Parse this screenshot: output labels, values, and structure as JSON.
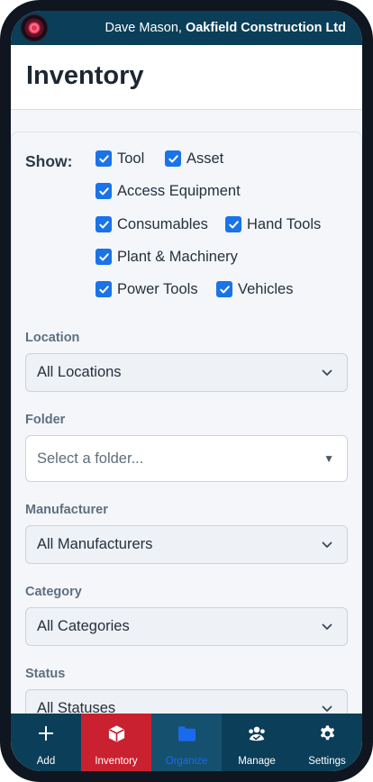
{
  "header": {
    "user_name": "Dave Mason,",
    "company": "Oakfield Construction Ltd"
  },
  "page": {
    "title": "Inventory"
  },
  "filters": {
    "show_label": "Show:",
    "checkboxes": [
      {
        "label": "Tool",
        "checked": true
      },
      {
        "label": "Asset",
        "checked": true
      },
      {
        "label": "Access Equipment",
        "checked": true
      },
      {
        "label": "Consumables",
        "checked": true
      },
      {
        "label": "Hand Tools",
        "checked": true
      },
      {
        "label": "Plant & Machinery",
        "checked": true
      },
      {
        "label": "Power Tools",
        "checked": true
      },
      {
        "label": "Vehicles",
        "checked": true
      }
    ],
    "location": {
      "label": "Location",
      "value": "All Locations"
    },
    "folder": {
      "label": "Folder",
      "placeholder": "Select a folder..."
    },
    "manufacturer": {
      "label": "Manufacturer",
      "value": "All Manufacturers"
    },
    "category": {
      "label": "Category",
      "value": "All Categories"
    },
    "status": {
      "label": "Status",
      "value": "All Statuses"
    }
  },
  "nav": {
    "items": [
      {
        "label": "Add",
        "icon": "plus-icon"
      },
      {
        "label": "Inventory",
        "icon": "box-icon"
      },
      {
        "label": "Organize",
        "icon": "folder-icon"
      },
      {
        "label": "Manage",
        "icon": "people-icon"
      },
      {
        "label": "Settings",
        "icon": "gear-icon"
      }
    ]
  },
  "colors": {
    "header_bg": "#0b3e58",
    "checkbox_accent": "#1a73e8",
    "inventory_active": "#c9212f",
    "organize_text": "#1a6af0"
  }
}
